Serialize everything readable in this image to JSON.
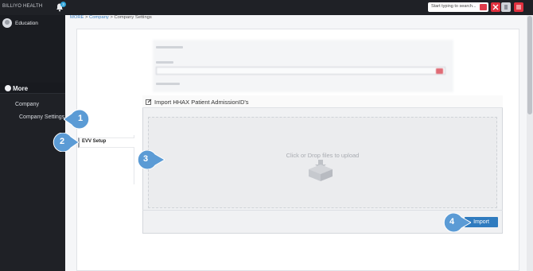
{
  "app": {
    "brand": "BILLIYO HEALTH",
    "notification_count": "3"
  },
  "user": {
    "name": "Education"
  },
  "search": {
    "placeholder": "Start typing to search..."
  },
  "sidebar": {
    "more_label": "More",
    "company_label": "Company",
    "company_settings_label": "Company Settings"
  },
  "breadcrumb": {
    "more": "MORE",
    "sep1": " > ",
    "company": "Company",
    "sep2": " > ",
    "current": "Company Settings"
  },
  "tabs": {
    "evv_label": "EVV Setup"
  },
  "modal": {
    "title": "Import HHAX Patient AdmissionID's",
    "drop_text": "Click or Drop files to upload",
    "import_label": "Import"
  },
  "callouts": [
    "1",
    "2",
    "3",
    "4"
  ],
  "colors": {
    "accent": "#2f7bbf",
    "callout": "#5b9bd5",
    "danger": "#e0303e",
    "sidebar": "#1a1c21"
  }
}
